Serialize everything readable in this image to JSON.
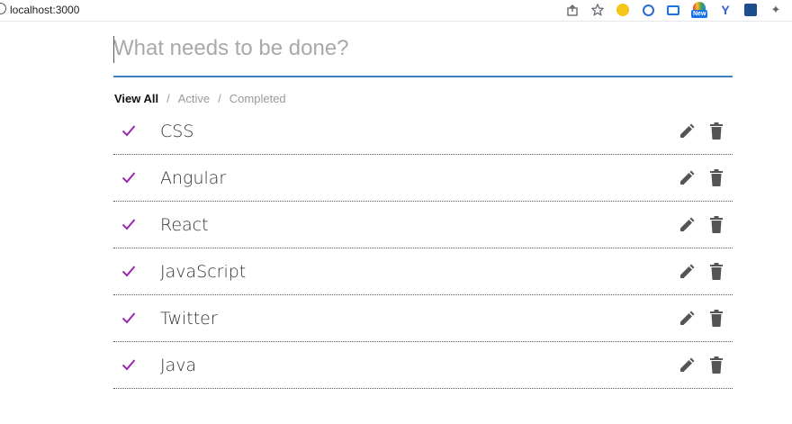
{
  "browser": {
    "url": "localhost:3000",
    "icons": [
      "info-icon",
      "share-icon",
      "star-icon",
      "emoji-extension-icon",
      "cc-extension-icon",
      "screen-extension-icon",
      "new-extension-icon",
      "y-extension-icon",
      "box-extension-icon",
      "puzzle-extension-icon"
    ],
    "new_badge": "New"
  },
  "todo_input": {
    "placeholder": "What needs to be done?",
    "value": ""
  },
  "filters": {
    "view_all": "View All",
    "active": "Active",
    "completed": "Completed",
    "separator": "/",
    "selected": "View All"
  },
  "colors": {
    "check": "#9c27b0",
    "action_icon": "#555555",
    "input_underline": "#3f7fbf"
  },
  "todos": [
    {
      "text": "CSS",
      "completed": true
    },
    {
      "text": "Angular",
      "completed": true
    },
    {
      "text": "React",
      "completed": true
    },
    {
      "text": "JavaScript",
      "completed": true
    },
    {
      "text": "Twitter",
      "completed": true
    },
    {
      "text": "Java",
      "completed": true
    }
  ]
}
